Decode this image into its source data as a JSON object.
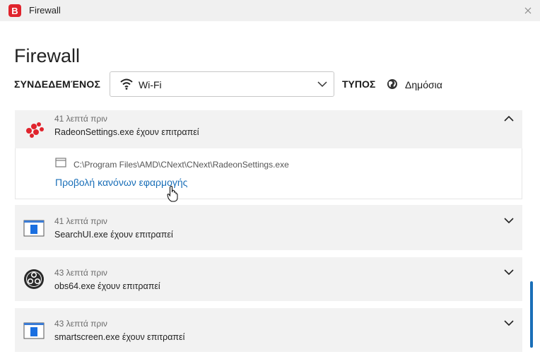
{
  "window": {
    "title": "Firewall",
    "logo_letter": "B"
  },
  "page": {
    "title": "Firewall"
  },
  "connection": {
    "label": "ΣΥΝΔΕΔΕΜΈΝΟΣ",
    "network": "Wi-Fi",
    "type_label": "ΤΥΠΟΣ",
    "type_value": "Δημόσια"
  },
  "items": [
    {
      "time": "41 λεπτά πριν",
      "desc": "RadeonSettings.exe έχουν επιτραπεί",
      "icon": "amd-radeon-icon",
      "expanded": true,
      "path": "C:\\Program Files\\AMD\\CNext\\CNext\\RadeonSettings.exe",
      "link": "Προβολή κανόνων εφαρμογής"
    },
    {
      "time": "41 λεπτά πριν",
      "desc": "SearchUI.exe έχουν επιτραπεί",
      "icon": "app-window-icon",
      "expanded": false
    },
    {
      "time": "43 λεπτά πριν",
      "desc": "obs64.exe έχουν επιτραπεί",
      "icon": "obs-icon",
      "expanded": false
    },
    {
      "time": "43 λεπτά πριν",
      "desc": "smartscreen.exe έχουν επιτραπεί",
      "icon": "app-window-icon",
      "expanded": false
    }
  ],
  "colors": {
    "accent": "#1a6fb8",
    "brand": "#e0242d",
    "item_bg": "#f2f2f2"
  }
}
